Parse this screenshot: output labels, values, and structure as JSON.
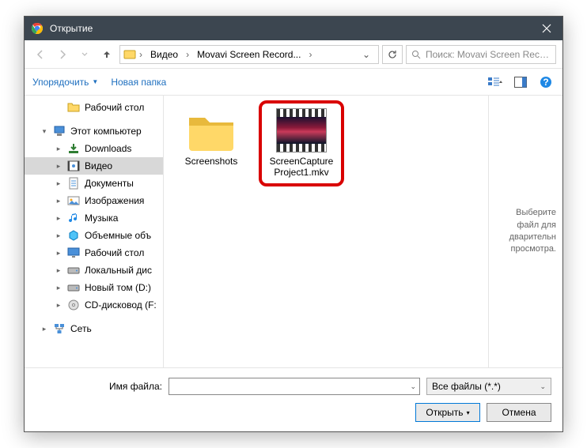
{
  "titlebar": {
    "title": "Открытие"
  },
  "breadcrumb": {
    "items": [
      "Видео",
      "Movavi Screen Record..."
    ]
  },
  "search": {
    "placeholder": "Поиск: Movavi Screen Recor..."
  },
  "toolbar": {
    "organize": "Упорядочить",
    "newfolder": "Новая папка"
  },
  "tree": {
    "items": [
      {
        "label": "Рабочий стол",
        "icon": "folder",
        "indent": true
      },
      {
        "label": "Этот компьютер",
        "icon": "pc",
        "exp": "▾"
      },
      {
        "label": "Downloads",
        "icon": "downloads",
        "indent": true,
        "exp": "▸"
      },
      {
        "label": "Видео",
        "icon": "video",
        "indent": true,
        "exp": "▸",
        "sel": true
      },
      {
        "label": "Документы",
        "icon": "docs",
        "indent": true,
        "exp": "▸"
      },
      {
        "label": "Изображения",
        "icon": "images",
        "indent": true,
        "exp": "▸"
      },
      {
        "label": "Музыка",
        "icon": "music",
        "indent": true,
        "exp": "▸"
      },
      {
        "label": "Объемные объ",
        "icon": "3d",
        "indent": true,
        "exp": "▸"
      },
      {
        "label": "Рабочий стол",
        "icon": "desktop",
        "indent": true,
        "exp": "▸"
      },
      {
        "label": "Локальный дис",
        "icon": "disk",
        "indent": true,
        "exp": "▸"
      },
      {
        "label": "Новый том (D:)",
        "icon": "disk",
        "indent": true,
        "exp": "▸"
      },
      {
        "label": "CD-дисковод (F:",
        "icon": "cd",
        "indent": true,
        "exp": "▸"
      },
      {
        "label": "Сеть",
        "icon": "network",
        "exp": "▸"
      }
    ]
  },
  "files": {
    "items": [
      {
        "name": "Screenshots",
        "type": "folder"
      },
      {
        "name": "ScreenCaptureProject1.mkv",
        "type": "video",
        "highlight": true
      }
    ]
  },
  "preview": {
    "message": "Выберите файл для дварительн просмотра."
  },
  "footer": {
    "filename_label": "Имя файла:",
    "filename_value": "",
    "filter": "Все файлы (*.*)",
    "open": "Открыть",
    "cancel": "Отмена"
  }
}
